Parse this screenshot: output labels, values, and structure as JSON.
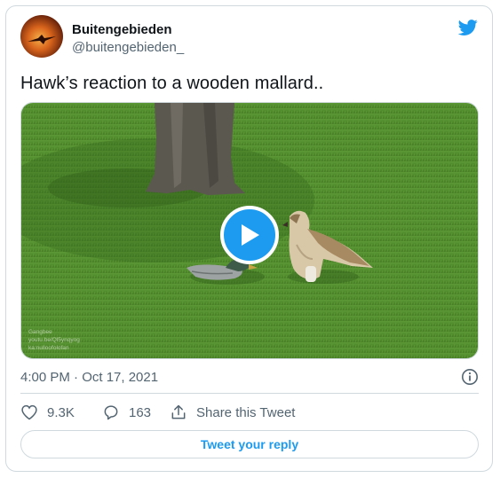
{
  "author": {
    "display_name": "Buitengebieden",
    "handle": "@buitengebieden_"
  },
  "tweet": {
    "text": "Hawk’s reaction to a wooden mallard..",
    "timestamp": "4:00 PM · Oct 17, 2021"
  },
  "media": {
    "type": "video",
    "watermark_lines": [
      "Gangbee",
      "youtu.be/Ql5ynqyog",
      "ka:nulloofolofan"
    ]
  },
  "actions": {
    "like_count": "9.3K",
    "reply_count": "163",
    "share_label": "Share this Tweet"
  },
  "reply_button_label": "Tweet your reply",
  "icons": {
    "logo": "twitter-bird-icon",
    "like": "heart-icon",
    "reply": "speech-bubble-icon",
    "share": "share-upload-icon",
    "info": "info-icon",
    "play": "play-icon"
  },
  "colors": {
    "accent": "#1d9bf0",
    "text_primary": "#0f1419",
    "text_secondary": "#536471",
    "border": "#cfd9de"
  }
}
